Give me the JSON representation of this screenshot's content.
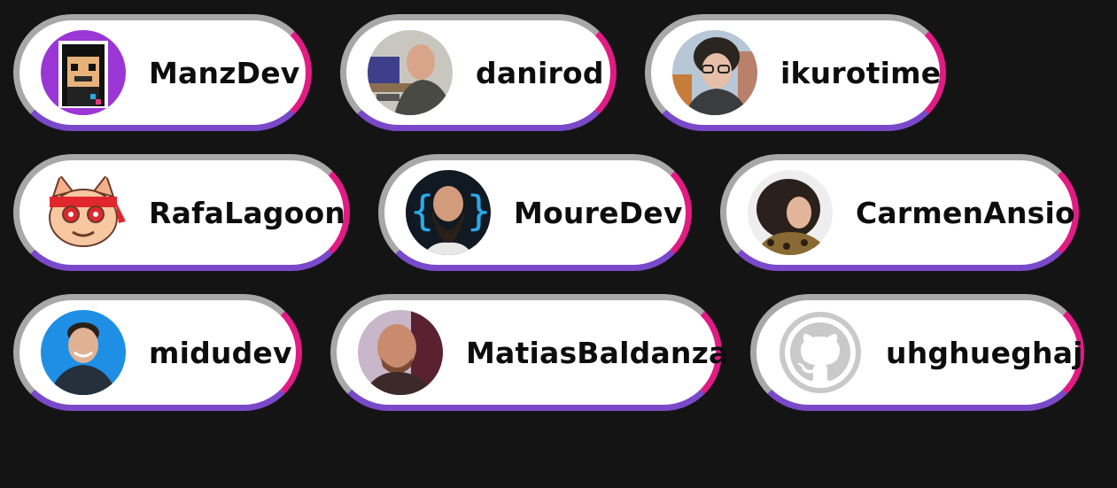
{
  "contributors": [
    {
      "name": "ManzDev",
      "avatar_icon": "pixel-art-avatar-icon"
    },
    {
      "name": "danirod",
      "avatar_icon": "photo-avatar-icon"
    },
    {
      "name": "ikurotime",
      "avatar_icon": "photo-avatar-icon"
    },
    {
      "name": "RafaLagoon",
      "avatar_icon": "cartoon-cat-avatar-icon"
    },
    {
      "name": "MoureDev",
      "avatar_icon": "photo-avatar-icon"
    },
    {
      "name": "CarmenAnsio",
      "avatar_icon": "photo-avatar-icon"
    },
    {
      "name": "midudev",
      "avatar_icon": "photo-avatar-icon"
    },
    {
      "name": "MatiasBaldanza",
      "avatar_icon": "photo-avatar-icon"
    },
    {
      "name": "uhghueghaj",
      "avatar_icon": "github-default-avatar-icon"
    }
  ],
  "colors": {
    "background": "#151415",
    "pill_border_gray": "#a8a8a8",
    "pill_accent_pink": "#e01c84",
    "pill_accent_purple": "#7a49c9",
    "pill_fill": "#ffffff",
    "text": "#0d0d0d"
  }
}
